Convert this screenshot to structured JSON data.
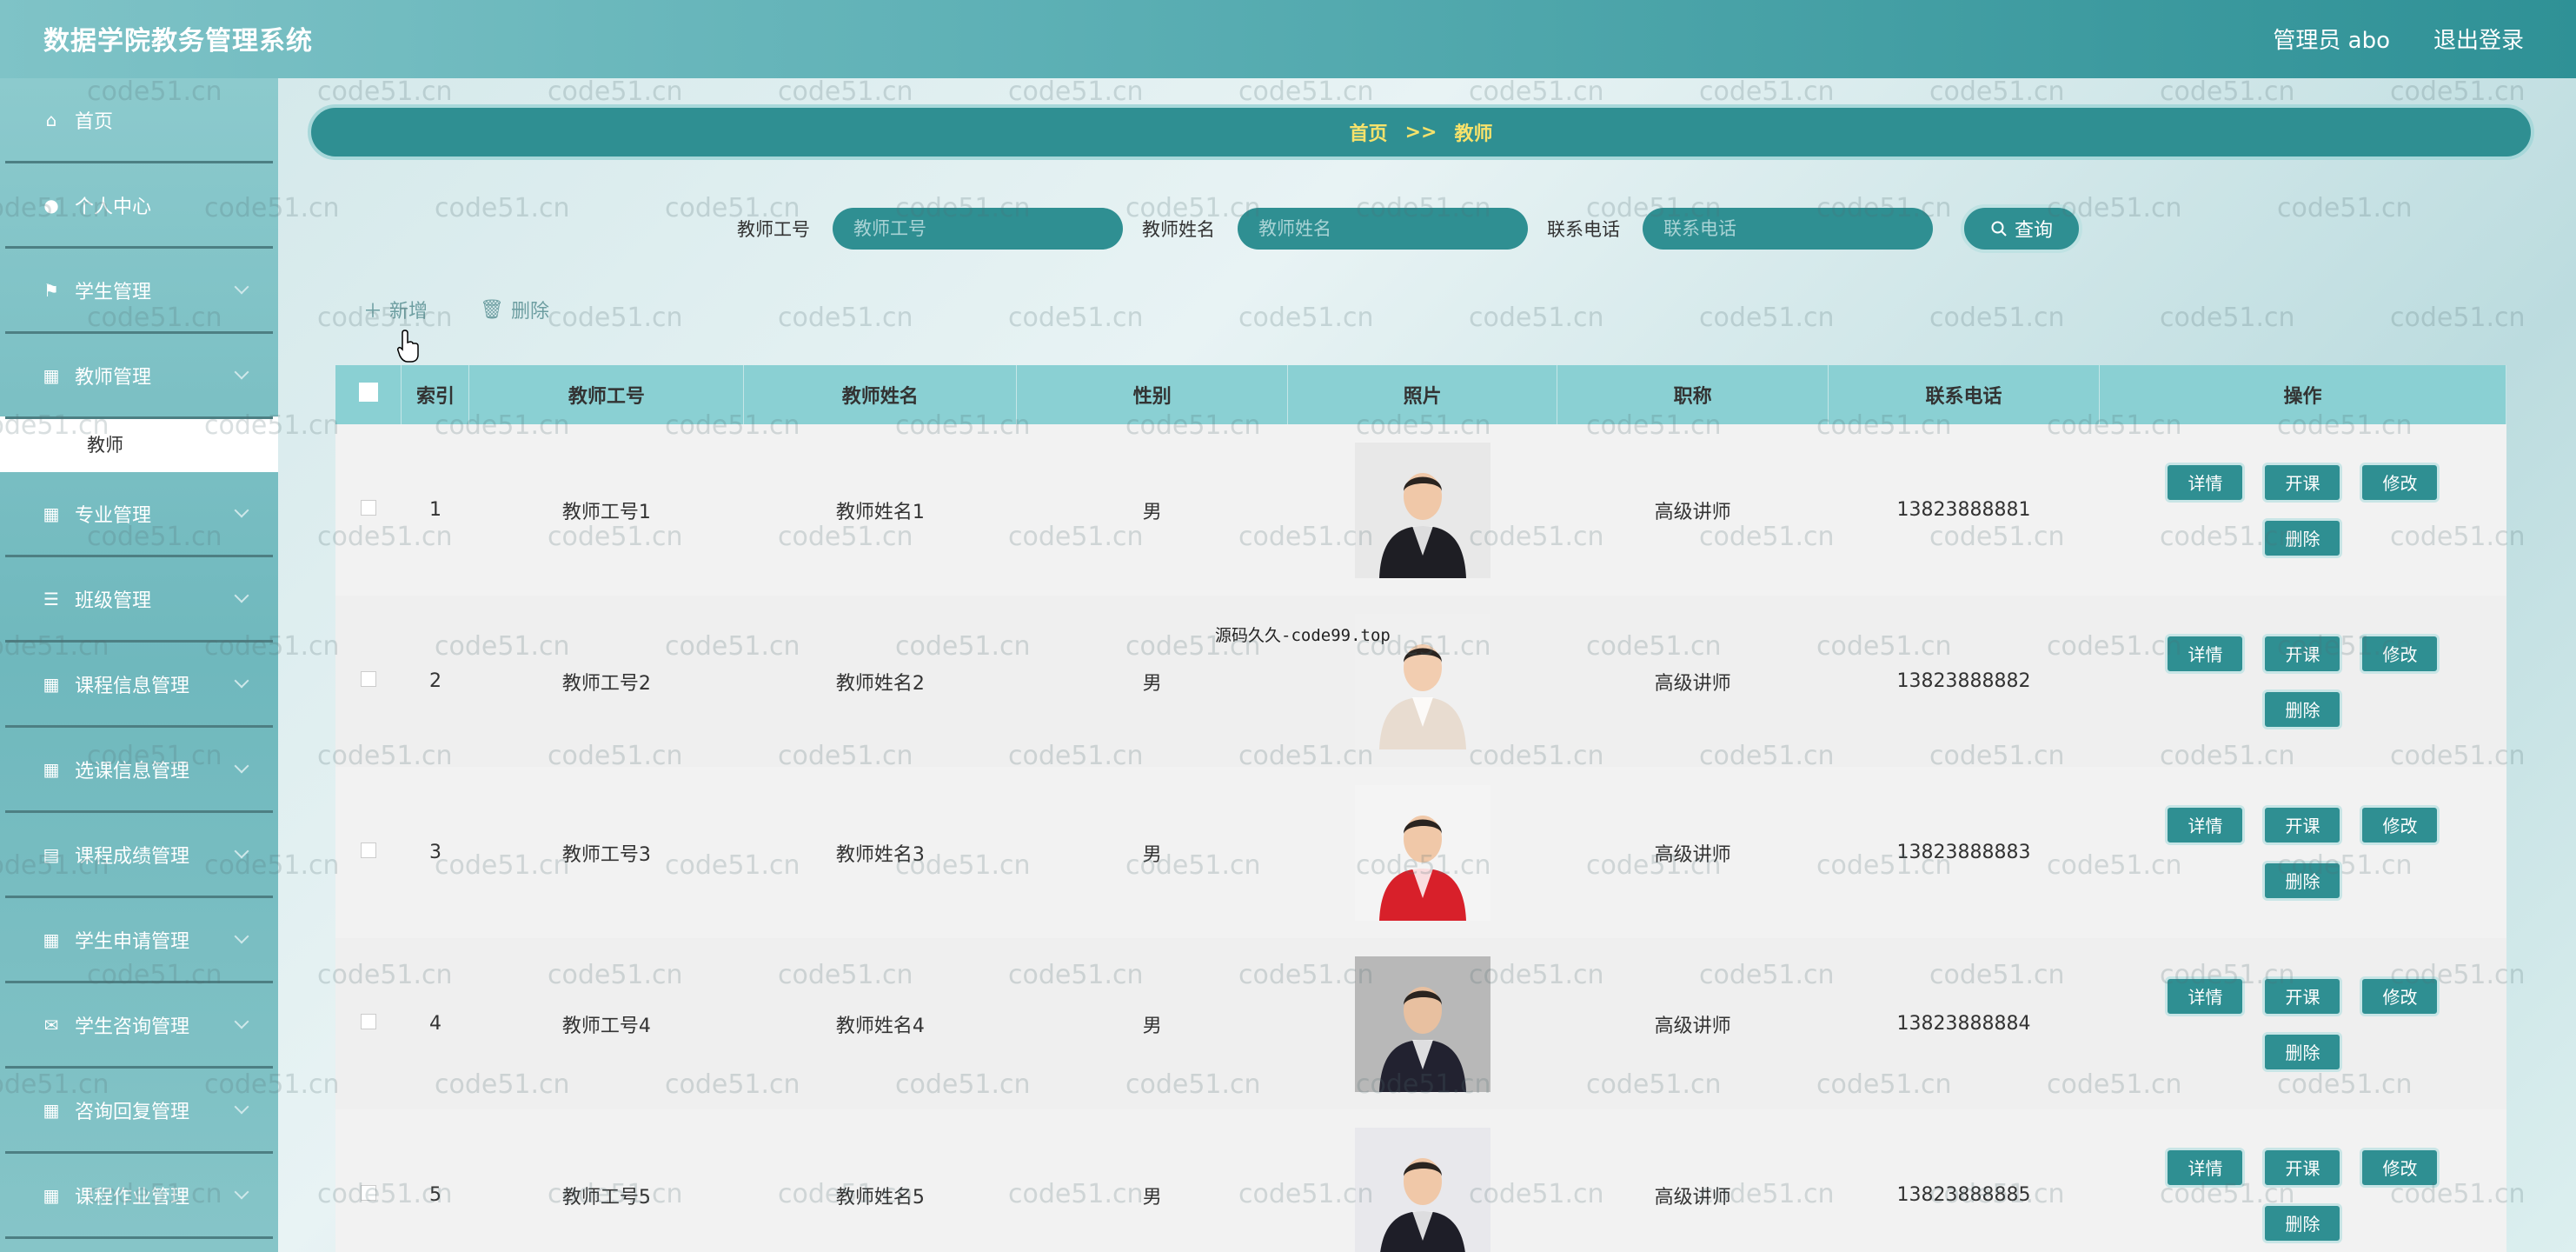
{
  "app": {
    "title": "数据学院教务管理系统"
  },
  "header": {
    "user_label": "管理员 abo",
    "logout_label": "退出登录"
  },
  "sidebar": {
    "items": [
      {
        "label": "首页",
        "icon": "home-icon"
      },
      {
        "label": "个人中心",
        "icon": "user-icon"
      },
      {
        "label": "学生管理",
        "icon": "flag-icon"
      },
      {
        "label": "教师管理",
        "icon": "grid-icon"
      },
      {
        "label": "专业管理",
        "icon": "grid-icon"
      },
      {
        "label": "班级管理",
        "icon": "list-icon"
      },
      {
        "label": "课程信息管理",
        "icon": "grid-icon"
      },
      {
        "label": "选课信息管理",
        "icon": "grid-icon"
      },
      {
        "label": "课程成绩管理",
        "icon": "inbox-icon"
      },
      {
        "label": "学生申请管理",
        "icon": "grid-icon"
      },
      {
        "label": "学生咨询管理",
        "icon": "chat-icon"
      },
      {
        "label": "咨询回复管理",
        "icon": "grid-icon"
      },
      {
        "label": "课程作业管理",
        "icon": "grid-icon"
      }
    ],
    "active_sub": "教师"
  },
  "breadcrumb": {
    "home": "首页",
    "sep": ">>",
    "current": "教师"
  },
  "search": {
    "id_label": "教师工号",
    "id_placeholder": "教师工号",
    "name_label": "教师姓名",
    "name_placeholder": "教师姓名",
    "phone_label": "联系电话",
    "phone_placeholder": "联系电话",
    "query_label": "查询"
  },
  "toolbar": {
    "add_label": "新增",
    "delete_label": "删除"
  },
  "table": {
    "headers": [
      "索引",
      "教师工号",
      "教师姓名",
      "性别",
      "照片",
      "职称",
      "联系电话",
      "操作"
    ],
    "op_labels": {
      "detail": "详情",
      "course": "开课",
      "edit": "修改",
      "delete": "删除"
    },
    "rows": [
      {
        "index": "1",
        "id": "教师工号1",
        "name": "教师姓名1",
        "gender": "男",
        "title": "高级讲师",
        "phone": "13823888881"
      },
      {
        "index": "2",
        "id": "教师工号2",
        "name": "教师姓名2",
        "gender": "男",
        "title": "高级讲师",
        "phone": "13823888882"
      },
      {
        "index": "3",
        "id": "教师工号3",
        "name": "教师姓名3",
        "gender": "男",
        "title": "高级讲师",
        "phone": "13823888883"
      },
      {
        "index": "4",
        "id": "教师工号4",
        "name": "教师姓名4",
        "gender": "男",
        "title": "高级讲师",
        "phone": "13823888884"
      },
      {
        "index": "5",
        "id": "教师工号5",
        "name": "教师姓名5",
        "gender": "男",
        "title": "高级讲师",
        "phone": "13823888885"
      }
    ]
  },
  "watermark": {
    "text": "code51.cn"
  },
  "overlay": {
    "text": "源码久久-code99.top"
  },
  "colors": {
    "primary": "#2f8f92",
    "header_bg": "#5db0b5",
    "table_header": "#8ad0d3",
    "breadcrumb_text": "#f7e26b"
  }
}
